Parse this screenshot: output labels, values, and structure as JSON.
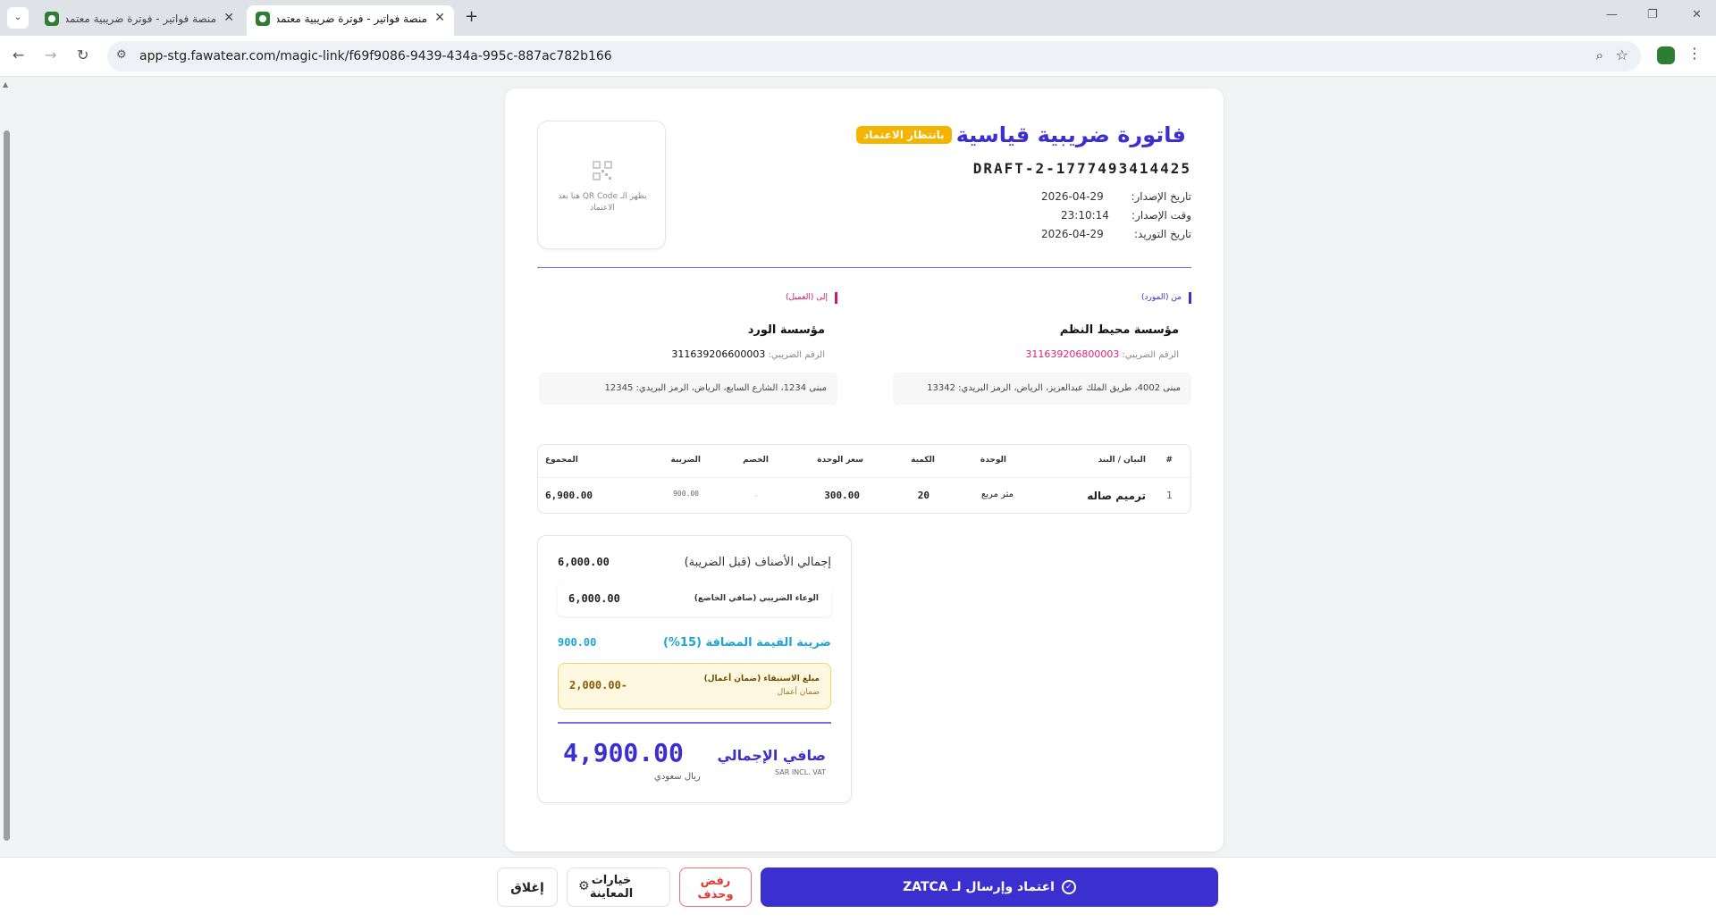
{
  "browser": {
    "tabs": [
      {
        "title": "منصة فواتير - فوترة ضريبية معتمدة",
        "active": false
      },
      {
        "title": "منصة فواتير - فوترة ضريبية معتمدة",
        "active": true
      }
    ],
    "url": "app-stg.fawatear.com/magic-link/f69f9086-9439-434a-995c-887ac782b166"
  },
  "invoice": {
    "status_badge": "بانتظار الاعتماد",
    "title": "فاتورة ضريبية قياسية",
    "number": "DRAFT-2-1777493414425",
    "qr_placeholder": "يظهر الـ QR Code هنا بعد الاعتماد",
    "meta": [
      {
        "label": "تاريخ الإصدار:",
        "value": "2026-04-29"
      },
      {
        "label": "وقت الإصدار:",
        "value": "23:10:14"
      },
      {
        "label": "تاريخ التوريد:",
        "value": "2026-04-29"
      }
    ],
    "from": {
      "tag": "من (المورد)",
      "name": "مؤسسة محيط النظم",
      "vat_label": "الرقم الضريبي:",
      "vat_number": "311639206800003",
      "address": "مبنى 4002، طريق الملك عبدالعزيز، الرياض، الرمز البريدي: 13342"
    },
    "to": {
      "tag": "إلى (العميل)",
      "name": "مؤسسة الورد",
      "vat_label": "الرقم الضريبي:",
      "vat_number": "311639206600003",
      "address": "مبنى 1234، الشارع السابع، الرياض، الرمز البريدي: 12345"
    },
    "table": {
      "headers": {
        "num": "#",
        "item": "البيان / البند",
        "unit": "الوحدة",
        "qty": "الكمية",
        "price": "سعر الوحدة",
        "discount": "الخصم",
        "tax": "الضريبة",
        "total": "المجموع"
      },
      "rows": [
        {
          "num": "1",
          "item": "ترميم صاله",
          "unit": "متر مربع",
          "qty": "20",
          "price": "300.00",
          "discount": "-",
          "tax": "900.00",
          "total": "6,900.00"
        }
      ]
    },
    "totals": {
      "subtotal_label": "إجمالي الأصناف (قبل الضريبة)",
      "subtotal": "6,000.00",
      "tax_base_label": "الوعاء الضريبي (صافي الخاضع)",
      "tax_base": "6,000.00",
      "vat_label": "ضريبة القيمة المضافة (15%)",
      "vat": "900.00",
      "retention_label": "مبلغ الاستبقاء (ضمان أعمال)",
      "retention_sub": "ضمان أعمال",
      "retention": "-2,000.00",
      "net_label": "صافي الإجمالي",
      "net_sub": "SAR INCL. VAT",
      "net": "4,900.00",
      "currency": "ريال سعودي"
    }
  },
  "actions": {
    "approve": "اعتماد وإرسال لـ ZATCA",
    "reject_line1": "رفض",
    "reject_line2": "وحذف",
    "preview_line1": "خيارات",
    "preview_line2": "المعاينة",
    "close": "إغلاق"
  },
  "colors": {
    "accent": "#3b2fd0",
    "status": "#f5b400",
    "vat": "#1ba5d8",
    "reject": "#e53935"
  }
}
